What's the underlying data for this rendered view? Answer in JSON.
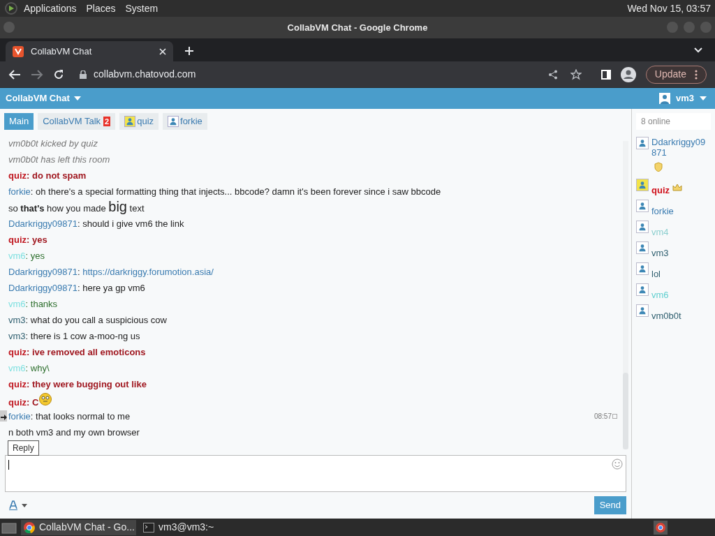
{
  "top_panel": {
    "menus": [
      "Applications",
      "Places",
      "System"
    ],
    "clock": "Wed Nov 15, 03:57"
  },
  "window": {
    "title": "CollabVM Chat - Google Chrome"
  },
  "browser": {
    "tab": "CollabVM Chat",
    "url": "collabvm.chatovod.com",
    "update": "Update"
  },
  "header": {
    "title": "CollabVM Chat",
    "user": "vm3"
  },
  "tabs": [
    {
      "label": "Main",
      "kind": "room",
      "selected": true
    },
    {
      "label": "CollabVM Talk",
      "kind": "room",
      "badge": "2",
      "selected": false
    },
    {
      "label": "quiz",
      "kind": "private",
      "highlighted": true,
      "selected": false
    },
    {
      "label": "forkie",
      "kind": "private",
      "highlighted": false,
      "selected": false
    }
  ],
  "messages": [
    {
      "kind": "system",
      "parts": [
        {
          "kind": "text",
          "text": "vm0b0t kicked by quiz"
        }
      ]
    },
    {
      "kind": "system",
      "parts": [
        {
          "kind": "text",
          "text": "vm0b0t has left this room"
        }
      ]
    },
    {
      "kind": "admin",
      "author": "quiz",
      "separator": ":",
      "color": "#c0161f",
      "parts": [
        {
          "kind": "text",
          "text": "do not spam"
        }
      ]
    },
    {
      "kind": "user",
      "author": "forkie",
      "separator": ":",
      "color": "#3a7bb0",
      "parts": [
        {
          "kind": "text",
          "text": "oh there's a special formatting thing that injects... bbcode? damn it's been forever since i saw bbcode"
        }
      ]
    },
    {
      "kind": "user",
      "parts": [
        {
          "kind": "text",
          "text": "so"
        },
        {
          "kind": "bold",
          "text": "that's"
        },
        {
          "kind": "text",
          "text": "how you made"
        },
        {
          "kind": "big",
          "text": "big"
        },
        {
          "kind": "text",
          "text": "text"
        }
      ]
    },
    {
      "kind": "user",
      "author": "Ddarkriggy09871",
      "separator": ":",
      "color": "#3a7bb0",
      "parts": [
        {
          "kind": "text",
          "text": "should i give vm6 the link"
        }
      ]
    },
    {
      "kind": "admin",
      "author": "quiz",
      "separator": ":",
      "color": "#c0161f",
      "parts": [
        {
          "kind": "text",
          "text": "yes"
        }
      ]
    },
    {
      "kind": "guest",
      "author": "vm6",
      "separator": ":",
      "color": "#7fe0e0",
      "parts": [
        {
          "kind": "text",
          "text": "yes"
        }
      ]
    },
    {
      "kind": "user",
      "author": "Ddarkriggy09871",
      "separator": ":",
      "color": "#3a7bb0",
      "parts": [
        {
          "kind": "link",
          "text": "https://darkriggy.forumotion.asia/"
        }
      ]
    },
    {
      "kind": "user",
      "author": "Ddarkriggy09871",
      "separator": ":",
      "color": "#3a7bb0",
      "parts": [
        {
          "kind": "text",
          "text": "here ya gp vm6"
        }
      ]
    },
    {
      "kind": "guest",
      "author": "vm6",
      "separator": ":",
      "color": "#7fe0e0",
      "parts": [
        {
          "kind": "text",
          "text": "thanks"
        }
      ]
    },
    {
      "kind": "user",
      "author": "vm3",
      "separator": ":",
      "color": "#2f5f6f",
      "parts": [
        {
          "kind": "text",
          "text": "what do you call a suspicious cow"
        }
      ]
    },
    {
      "kind": "user",
      "author": "vm3",
      "separator": ":",
      "color": "#2f5f6f",
      "parts": [
        {
          "kind": "text",
          "text": "there is 1 cow a-moo-ng us"
        }
      ]
    },
    {
      "kind": "admin",
      "author": "quiz",
      "separator": ":",
      "color": "#c0161f",
      "parts": [
        {
          "kind": "text",
          "text": "ive removed all emoticons"
        }
      ]
    },
    {
      "kind": "guest",
      "author": "vm6",
      "separator": ":",
      "color": "#7fe0e0",
      "parts": [
        {
          "kind": "text",
          "text": "why\\"
        }
      ]
    },
    {
      "kind": "admin",
      "author": "quiz",
      "separator": ":",
      "color": "#c0161f",
      "parts": [
        {
          "kind": "text",
          "text": "they were bugging out like"
        }
      ]
    },
    {
      "kind": "admin",
      "author": "quiz",
      "separator": ":",
      "color": "#c0161f",
      "parts": [
        {
          "kind": "text",
          "text": "C"
        },
        {
          "kind": "emoticon"
        }
      ]
    },
    {
      "kind": "user",
      "author": "forkie",
      "separator": ":",
      "color": "#3a7bb0",
      "time": "08:57",
      "hovered": true,
      "parts": [
        {
          "kind": "text",
          "text": "that looks normal to me"
        }
      ]
    },
    {
      "kind": "user",
      "parts": [
        {
          "kind": "text",
          "text": "n both vm3 and my own browser"
        }
      ]
    }
  ],
  "tooltip": "Reply",
  "input": {
    "send": "Send"
  },
  "users": {
    "count": "8 online",
    "items": [
      {
        "name": "Ddarkriggy09871",
        "kind": "moderator",
        "color": "#3a7bb0"
      },
      {
        "name": "quiz",
        "kind": "admin",
        "color": "#d0101a"
      },
      {
        "name": "forkie",
        "kind": "user",
        "color": "#3a7bb0"
      },
      {
        "name": "vm4",
        "kind": "user",
        "color": "#8ccfcf"
      },
      {
        "name": "vm3",
        "kind": "user",
        "color": "#2f5f6f"
      },
      {
        "name": "lol",
        "kind": "user",
        "color": "#2f5f6f"
      },
      {
        "name": "vm6",
        "kind": "user",
        "color": "#5fcfcf"
      },
      {
        "name": "vm0b0t",
        "kind": "user",
        "color": "#2f5f6f"
      }
    ]
  },
  "taskbar": [
    {
      "label": "CollabVM Chat - Go...",
      "kind": "chrome",
      "selected": true
    },
    {
      "label": "vm3@vm3:~",
      "kind": "terminal",
      "selected": false
    }
  ]
}
